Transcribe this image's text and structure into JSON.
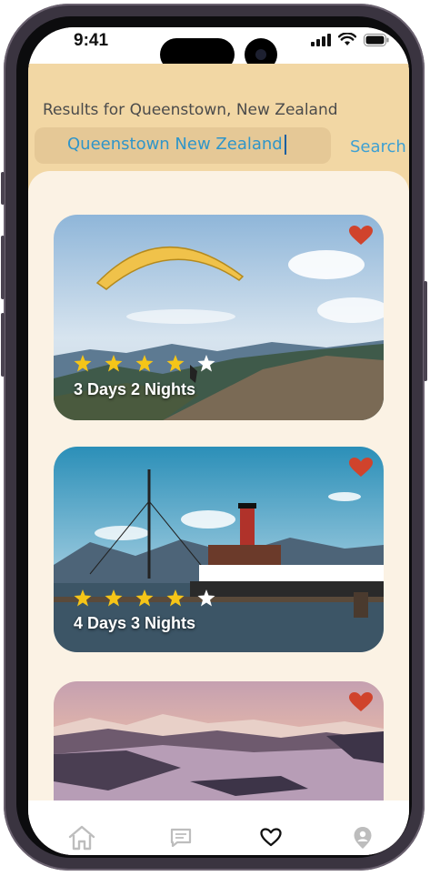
{
  "status_bar": {
    "time": "9:41"
  },
  "search": {
    "results_title": "Results for Queenstown, New Zealand",
    "query": "Queenstown New Zealand",
    "button_label": "Search"
  },
  "colors": {
    "header_bg": "#f2d7a4",
    "content_bg": "#fbf2e4",
    "accent_blue": "#3fa0d2",
    "heart_red": "#d0432c",
    "star_yellow": "#f5c518"
  },
  "results": [
    {
      "label": "3 Days 2 Nights",
      "rating": 4,
      "max_rating": 5,
      "favorited": true,
      "image": "paraglider-over-mountains"
    },
    {
      "label": "4 Days 3 Nights",
      "rating": 4,
      "max_rating": 5,
      "favorited": true,
      "image": "steamship-on-lake"
    },
    {
      "label": "",
      "rating": null,
      "max_rating": 5,
      "favorited": true,
      "image": "lake-sunset-mountains"
    }
  ],
  "bottom_nav": {
    "items": [
      {
        "icon": "home-icon",
        "active": false
      },
      {
        "icon": "chat-icon",
        "active": false
      },
      {
        "icon": "heart-outline-icon",
        "active": true
      },
      {
        "icon": "profile-icon",
        "active": false
      }
    ]
  }
}
